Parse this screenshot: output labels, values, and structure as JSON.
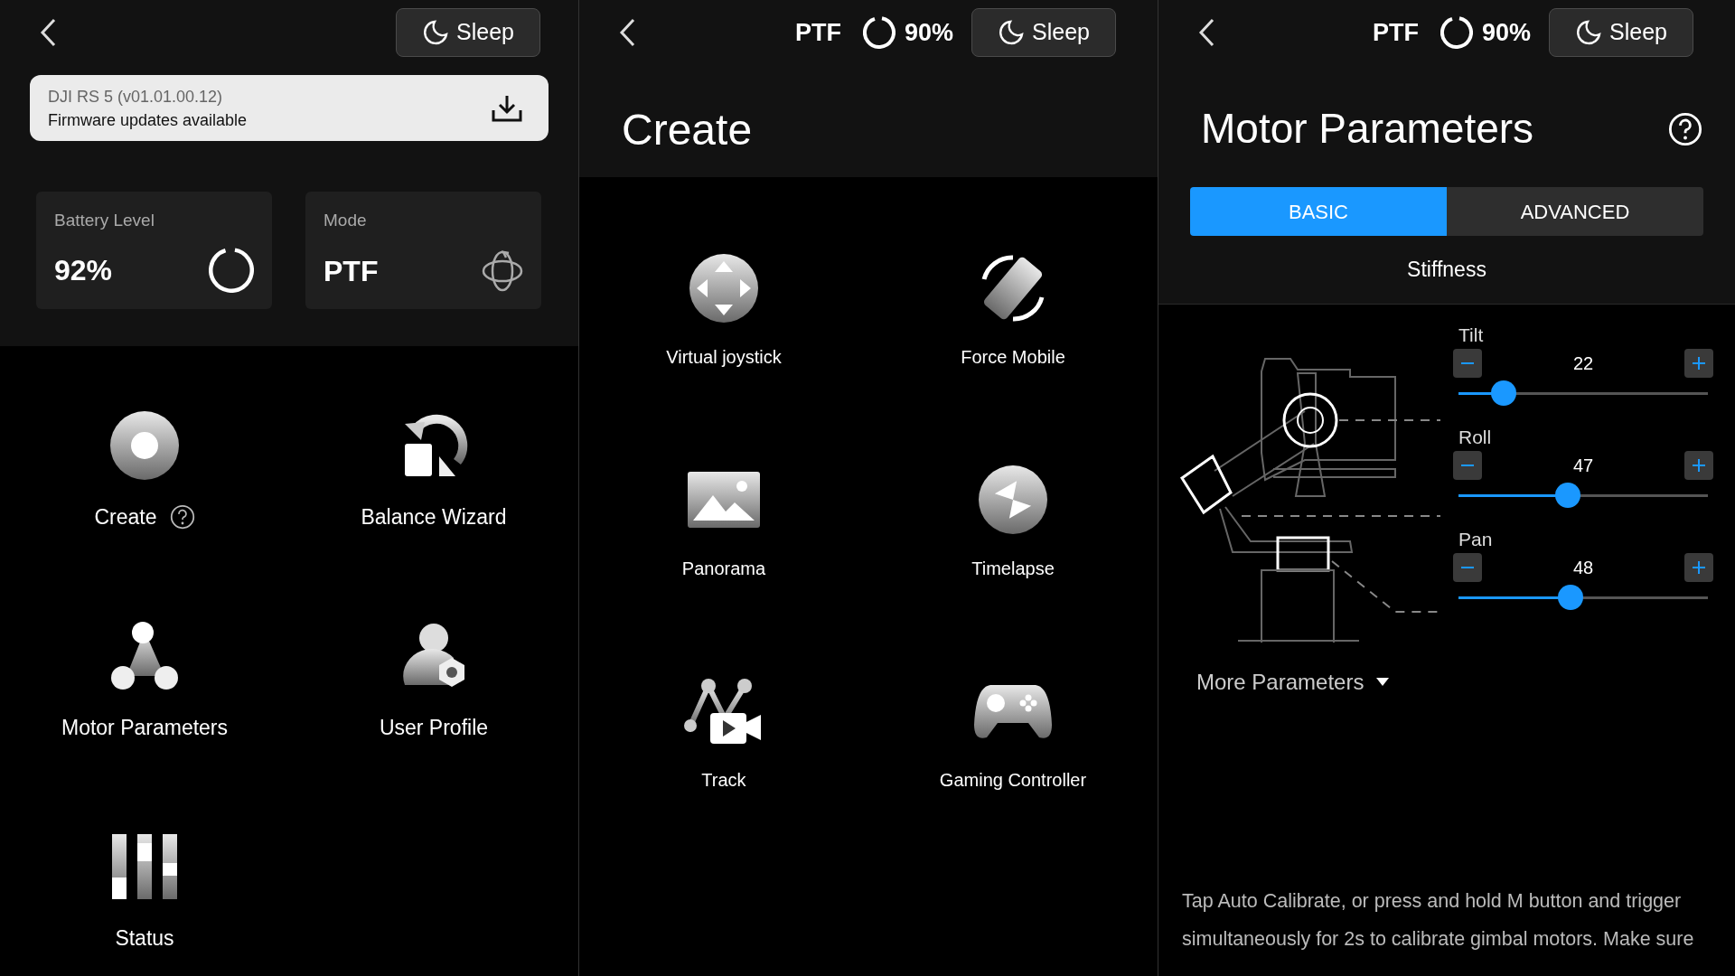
{
  "home": {
    "sleep": "Sleep",
    "banner": {
      "title": "DJI RS 5 (v01.01.00.12)",
      "message": "Firmware updates available"
    },
    "cards": [
      {
        "kind": "battery",
        "label": "Battery Level",
        "value": "92%",
        "level": 0.92
      },
      {
        "kind": "mode",
        "label": "Mode",
        "value": "PTF"
      }
    ],
    "menu": [
      {
        "kind": "create",
        "label": "Create",
        "help": true
      },
      {
        "kind": "balance",
        "label": "Balance Wizard",
        "help": false
      },
      {
        "kind": "motor",
        "label": "Motor Parameters",
        "help": false
      },
      {
        "kind": "profile",
        "label": "User Profile",
        "help": false
      },
      {
        "kind": "status",
        "label": "Status",
        "help": false
      }
    ]
  },
  "create": {
    "mode": "PTF",
    "battery": {
      "value": "90%"
    },
    "sleep": "Sleep",
    "title": "Create",
    "items": [
      {
        "kind": "joystick",
        "label": "Virtual joystick"
      },
      {
        "kind": "force",
        "label": "Force Mobile"
      },
      {
        "kind": "panorama",
        "label": "Panorama"
      },
      {
        "kind": "timelapse",
        "label": "Timelapse"
      },
      {
        "kind": "track",
        "label": "Track"
      },
      {
        "kind": "gamepad",
        "label": "Gaming Controller"
      }
    ]
  },
  "motor": {
    "mode": "PTF",
    "battery": {
      "value": "90%"
    },
    "sleep": "Sleep",
    "title": "Motor Parameters",
    "tabs": [
      {
        "label": "BASIC",
        "selected": true
      },
      {
        "label": "ADVANCED",
        "selected": false
      }
    ],
    "section": "Stiffness",
    "sliders": [
      {
        "name": "Tilt",
        "value": "22",
        "level": 0.18
      },
      {
        "name": "Roll",
        "value": "47",
        "level": 0.44
      },
      {
        "name": "Pan",
        "value": "48",
        "level": 0.45
      }
    ],
    "more": "More Parameters",
    "note": "Tap Auto Calibrate, or press and hold M button and trigger simultaneously for 2s to calibrate gimbal motors. Make sure"
  }
}
